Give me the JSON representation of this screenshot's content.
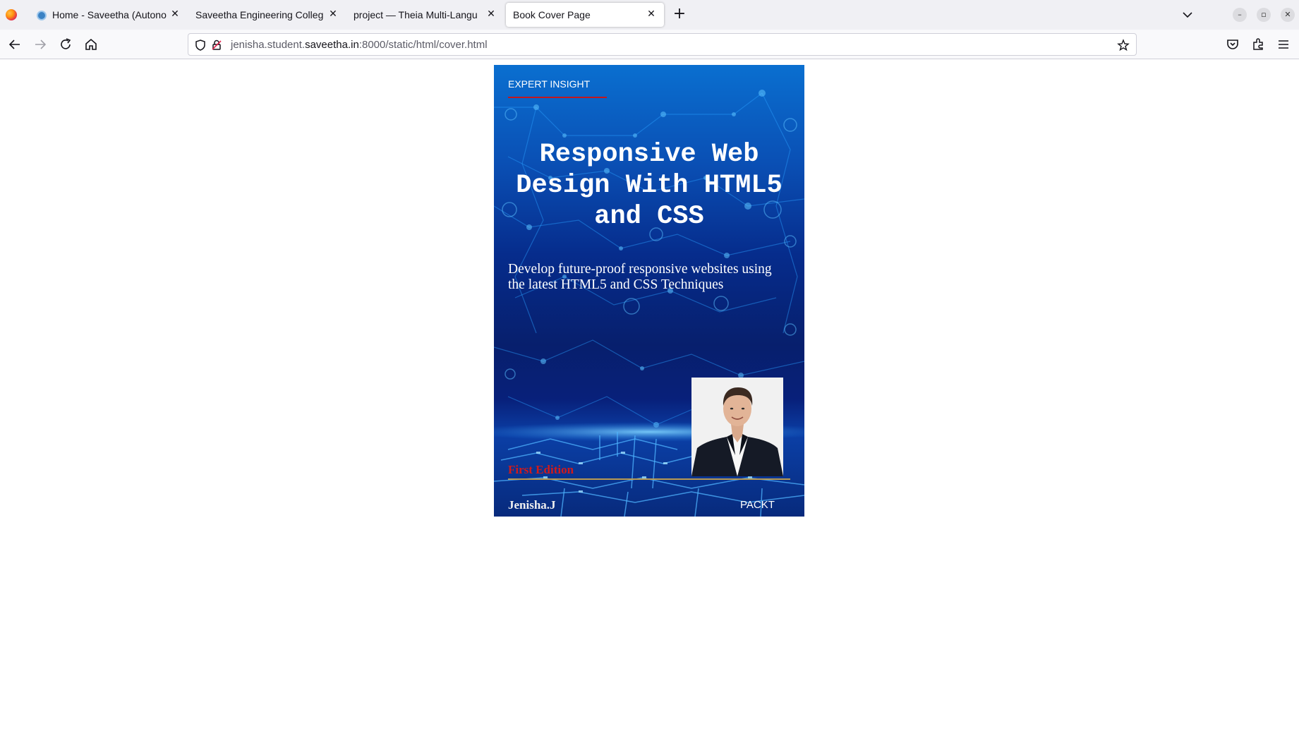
{
  "browser": {
    "tabs": [
      {
        "title": "Home - Saveetha (Autono",
        "active": false
      },
      {
        "title": "Saveetha Engineering Colleg",
        "active": false
      },
      {
        "title": "project — Theia Multi-Langu",
        "active": false
      },
      {
        "title": "Book Cover Page",
        "active": true
      }
    ],
    "url": {
      "prefix": "jenisha.student.",
      "host": "saveetha.in",
      "suffix": ":8000/static/html/cover.html"
    }
  },
  "cover": {
    "series_label": "EXPERT INSIGHT",
    "title": "Responsive Web Design With HTML5 and CSS",
    "subtitle": "Develop future-proof responsive websites using the latest HTML5 and CSS Techniques",
    "edition": "First Edition",
    "author": "Jenisha.J",
    "publisher": "PACKT"
  },
  "colors": {
    "edition_red": "#d11a1a",
    "rule_red": "#c4161c",
    "rule_gold": "#b89a52",
    "cover_blue": "#062c8c"
  }
}
